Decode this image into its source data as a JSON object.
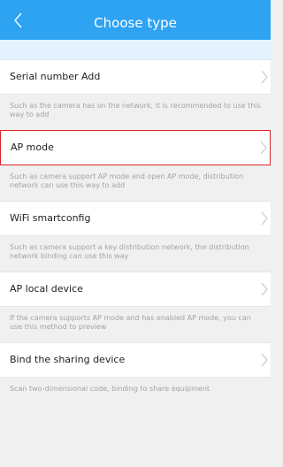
{
  "header": {
    "title": "Choose type",
    "back_icon": "chevron-left-icon",
    "background": "#2da3f2"
  },
  "options": [
    {
      "label": "Serial number Add",
      "description": "Such as the camera has on the network, it is recommended to use this way to add",
      "selected": false
    },
    {
      "label": "AP mode",
      "description": "Such as camera support AP mode and open AP mode, distribution network can use this way to add",
      "selected": true
    },
    {
      "label": "WiFi smartconfig",
      "description": "Such as camera support a key distribution network, the distribution network binding can use this way",
      "selected": false
    },
    {
      "label": "AP local device",
      "description": "If the camera supports AP mode and has enabled AP mode, you can use this method to preview",
      "selected": false
    },
    {
      "label": "Bind the sharing device",
      "description": "Scan two-dimensional code, binding to share equipment",
      "selected": false
    }
  ],
  "colors": {
    "selected_border": "#d9262c",
    "chevron": "#c4c4c4"
  }
}
